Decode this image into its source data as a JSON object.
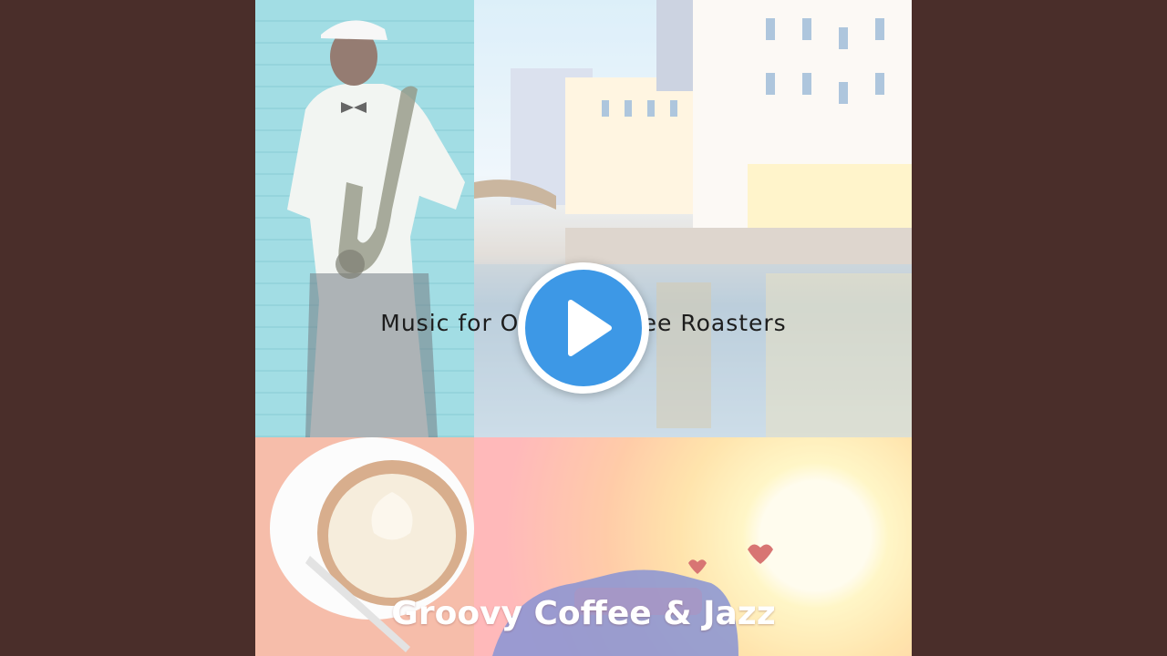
{
  "video": {
    "title_overlay": "Music for Or",
    "title_overlay_end": "ee Roasters",
    "artist_overlay": "Groovy Coffee & Jazz",
    "play_icon": "play-icon"
  },
  "colors": {
    "background": "#4a2e2a",
    "play_button": "#3d98e6",
    "play_button_ring": "#ffffff"
  }
}
